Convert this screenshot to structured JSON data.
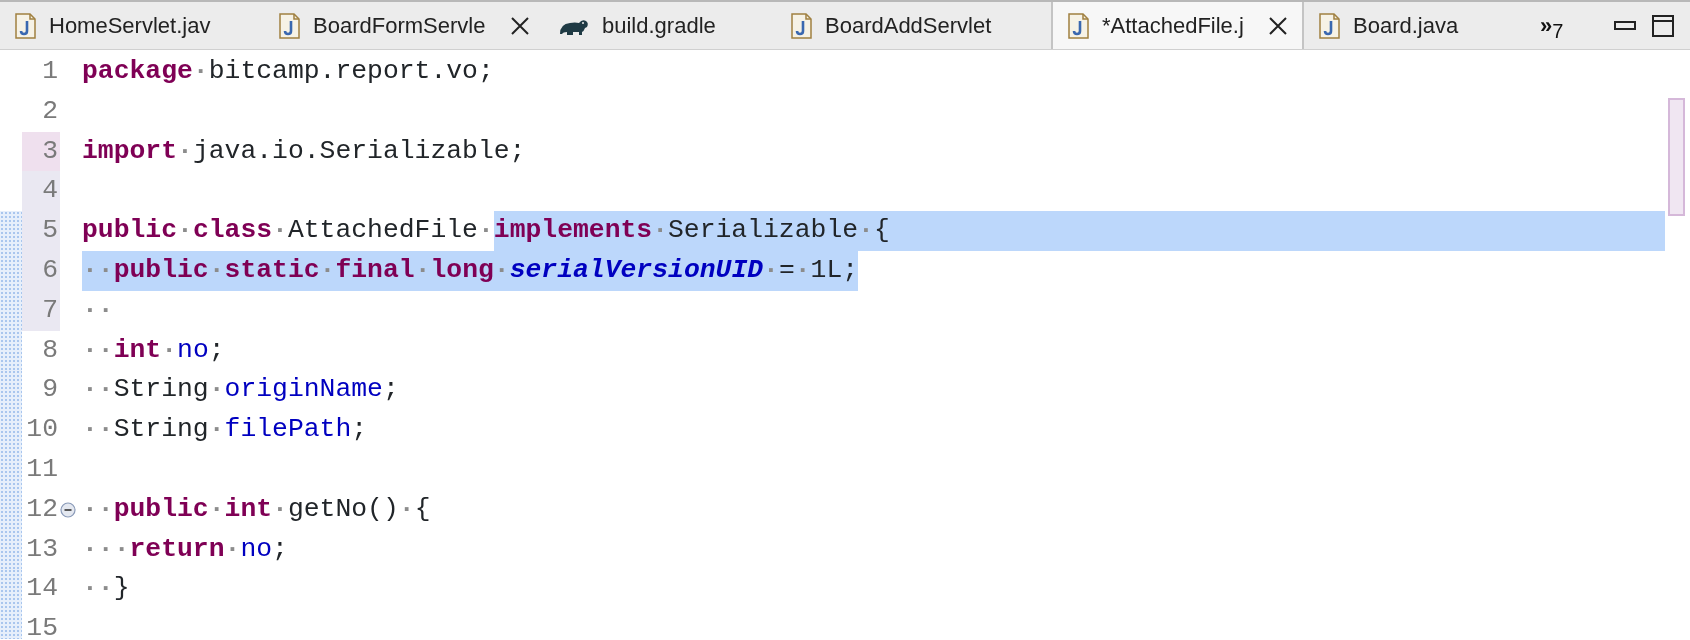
{
  "tabs": [
    {
      "kind": "java",
      "label": "HomeServlet.jav",
      "selected": false,
      "close_button": false
    },
    {
      "kind": "java",
      "label": "BoardFormServle",
      "selected": false,
      "close_button": true
    },
    {
      "kind": "gradle",
      "label": "build.gradle",
      "selected": false,
      "close_button": false
    },
    {
      "kind": "java",
      "label": "BoardAddServlet",
      "selected": false,
      "close_button": false
    },
    {
      "kind": "java",
      "label": "*AttachedFile.j",
      "selected": true,
      "close_button": true
    },
    {
      "kind": "java",
      "label": "Board.java",
      "selected": false,
      "close_button": false
    }
  ],
  "overflow": "»$_{7}$",
  "editor": {
    "lines": [
      {
        "number": "1",
        "tokens": [
          {
            "kind": "keyword",
            "text": "package"
          },
          {
            "kind": "ws",
            "text": "·"
          },
          {
            "kind": "plain",
            "text": "bitcamp.report.vo;"
          }
        ]
      },
      {
        "number": "2"
      },
      {
        "number": "3",
        "marked": true,
        "tokens": [
          {
            "kind": "keyword",
            "text": "import"
          },
          {
            "kind": "ws",
            "text": "·"
          },
          {
            "kind": "plain",
            "text": "java.io.Serializable;"
          }
        ]
      },
      {
        "number": "4",
        "in_range": true
      },
      {
        "number": "5",
        "in_range": true,
        "changed": true,
        "eol_selected": true,
        "tokens": [
          {
            "kind": "keyword",
            "text": "public"
          },
          {
            "kind": "ws",
            "text": "·"
          },
          {
            "kind": "keyword",
            "text": "class"
          },
          {
            "kind": "ws",
            "text": "·"
          },
          {
            "kind": "plain",
            "text": "AttachedFile"
          },
          {
            "kind": "ws",
            "text": "·"
          },
          {
            "kind": "keyword",
            "text": "implements",
            "selected": true
          },
          {
            "kind": "ws",
            "text": "·",
            "selected": true
          },
          {
            "kind": "plain",
            "text": "Serializable",
            "selected": true
          },
          {
            "kind": "ws",
            "text": "·",
            "selected": true
          },
          {
            "kind": "plain",
            "text": "{",
            "selected": true
          }
        ]
      },
      {
        "number": "6",
        "in_range": true,
        "changed": true,
        "tokens": [
          {
            "kind": "ws",
            "text": "··",
            "selected": true
          },
          {
            "kind": "keyword",
            "text": "public",
            "selected": true
          },
          {
            "kind": "ws",
            "text": "·",
            "selected": true
          },
          {
            "kind": "keyword",
            "text": "static",
            "selected": true
          },
          {
            "kind": "ws",
            "text": "·",
            "selected": true
          },
          {
            "kind": "keyword",
            "text": "final",
            "selected": true
          },
          {
            "kind": "ws",
            "text": "·",
            "selected": true
          },
          {
            "kind": "keyword",
            "text": "long",
            "selected": true
          },
          {
            "kind": "ws",
            "text": "·",
            "selected": true
          },
          {
            "kind": "static",
            "text": "serialVersionUID",
            "selected": true
          },
          {
            "kind": "ws",
            "text": "·",
            "selected": true
          },
          {
            "kind": "plain",
            "text": "=",
            "selected": true
          },
          {
            "kind": "ws",
            "text": "·",
            "selected": true
          },
          {
            "kind": "plain",
            "text": "1L;",
            "selected": true
          }
        ]
      },
      {
        "number": "7",
        "in_range": true,
        "changed": true,
        "tokens": [
          {
            "kind": "ws",
            "text": "··"
          }
        ]
      },
      {
        "number": "8",
        "changed": true,
        "tokens": [
          {
            "kind": "ws",
            "text": "··"
          },
          {
            "kind": "keyword",
            "text": "int"
          },
          {
            "kind": "ws",
            "text": "·"
          },
          {
            "kind": "field",
            "text": "no"
          },
          {
            "kind": "plain",
            "text": ";"
          }
        ]
      },
      {
        "number": "9",
        "changed": true,
        "tokens": [
          {
            "kind": "ws",
            "text": "··"
          },
          {
            "kind": "plain",
            "text": "String"
          },
          {
            "kind": "ws",
            "text": "·"
          },
          {
            "kind": "field",
            "text": "originName"
          },
          {
            "kind": "plain",
            "text": ";"
          }
        ]
      },
      {
        "number": "10",
        "changed": true,
        "tokens": [
          {
            "kind": "ws",
            "text": "··"
          },
          {
            "kind": "plain",
            "text": "String"
          },
          {
            "kind": "ws",
            "text": "·"
          },
          {
            "kind": "field",
            "text": "filePath"
          },
          {
            "kind": "plain",
            "text": ";"
          }
        ]
      },
      {
        "number": "11",
        "changed": true
      },
      {
        "number": "12",
        "changed": true,
        "foldable": true,
        "tokens": [
          {
            "kind": "ws",
            "text": "··"
          },
          {
            "kind": "keyword",
            "text": "public"
          },
          {
            "kind": "ws",
            "text": "·"
          },
          {
            "kind": "keyword",
            "text": "int"
          },
          {
            "kind": "ws",
            "text": "·"
          },
          {
            "kind": "plain",
            "text": "getNo()"
          },
          {
            "kind": "ws",
            "text": "·"
          },
          {
            "kind": "plain",
            "text": "{"
          }
        ]
      },
      {
        "number": "13",
        "changed": true,
        "tokens": [
          {
            "kind": "ws",
            "text": "···"
          },
          {
            "kind": "keyword",
            "text": "return"
          },
          {
            "kind": "ws",
            "text": "·"
          },
          {
            "kind": "field",
            "text": "no"
          },
          {
            "kind": "plain",
            "text": ";"
          }
        ]
      },
      {
        "number": "14",
        "changed": true,
        "tokens": [
          {
            "kind": "ws",
            "text": "··"
          },
          {
            "kind": "plain",
            "text": "}"
          }
        ]
      },
      {
        "number": "15",
        "changed": true
      }
    ]
  }
}
